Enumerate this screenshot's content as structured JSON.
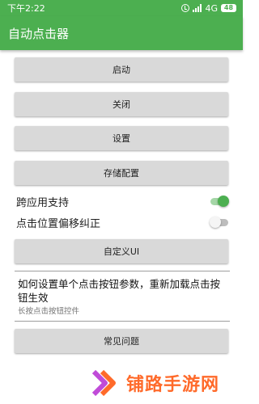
{
  "status_bar": {
    "time": "下午2:22",
    "network": "4G",
    "battery": "48"
  },
  "app_bar": {
    "title": "自动点击器"
  },
  "buttons": {
    "start": "启动",
    "close": "关闭",
    "settings": "设置",
    "save_config": "存储配置",
    "custom_ui": "自定义UI",
    "faq": "常见问题"
  },
  "switches": [
    {
      "label": "跨应用支持",
      "checked": true
    },
    {
      "label": "点击位置偏移纠正",
      "checked": false
    }
  ],
  "help": {
    "title": "如何设置单个点击按钮参数，重新加载点击按钮生效",
    "subtitle": "长按点击按钮控件"
  },
  "watermark": {
    "text": "铺路手游网"
  },
  "colors": {
    "accent": "#4caf50",
    "button_bg": "#d9d9d9",
    "watermark": "#ff6a2a"
  }
}
